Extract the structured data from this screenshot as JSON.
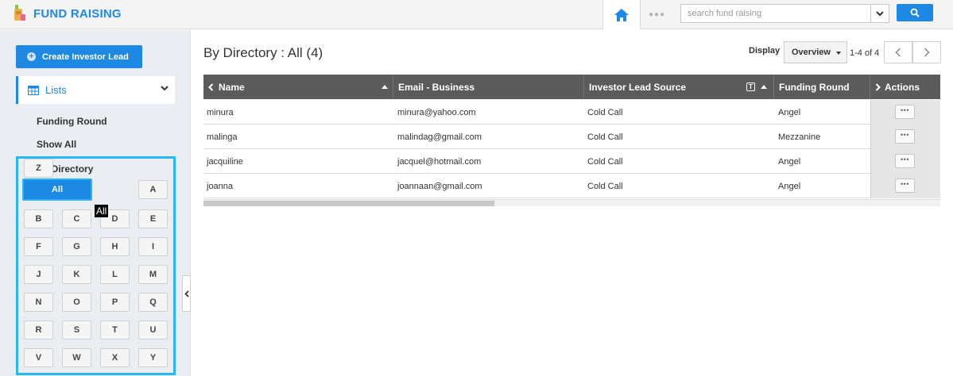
{
  "app": {
    "title": "FUND RAISING",
    "accent_color": "#1e88e5",
    "highlight_color": "#29b6f6"
  },
  "topbar": {
    "home_icon": "home-icon",
    "more_icon": "more-dots-icon",
    "search": {
      "placeholder": "search fund raising",
      "value": ""
    },
    "search_icon": "search-icon"
  },
  "sidebar": {
    "create_button": "Create Investor Lead",
    "lists_label": "Lists",
    "links": [
      "Funding Round",
      "Show All"
    ],
    "directory": {
      "title": "By Directory",
      "selected": "All",
      "tooltip": "All",
      "letters": [
        "All",
        "A",
        "B",
        "C",
        "D",
        "E",
        "F",
        "G",
        "H",
        "I",
        "J",
        "K",
        "L",
        "M",
        "N",
        "O",
        "P",
        "Q",
        "R",
        "S",
        "T",
        "U",
        "V",
        "W",
        "X",
        "Y",
        "Z"
      ]
    }
  },
  "main": {
    "title": "By Directory : All (4)",
    "display_label": "Display",
    "display_value": "Overview",
    "pager_text": "1-4 of 4",
    "columns": [
      "Name",
      "Email - Business",
      "Investor Lead Source",
      "Funding Round",
      "Actions"
    ],
    "rows": [
      {
        "name": "minura",
        "email": "minura@yahoo.com",
        "source": "Cold Call",
        "round": "Angel"
      },
      {
        "name": "malinga",
        "email": "malindag@gmail.com",
        "source": "Cold Call",
        "round": "Mezzanine"
      },
      {
        "name": "jacquiline",
        "email": "jacquel@hotmail.com",
        "source": "Cold Call",
        "round": "Angel"
      },
      {
        "name": "joanna",
        "email": "joannaan@gmail.com",
        "source": "Cold Call",
        "round": "Angel"
      }
    ],
    "actions_label": "•••"
  }
}
